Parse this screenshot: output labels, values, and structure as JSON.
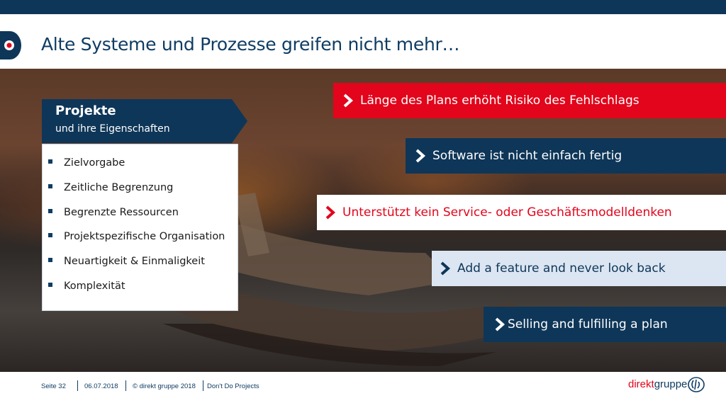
{
  "header": {
    "title": "Alte Systeme und Prozesse greifen nicht mehr…"
  },
  "projects": {
    "title": "Projekte",
    "subtitle": "und ihre Eigenschaften",
    "items": [
      "Zielvorgabe",
      "Zeitliche Begrenzung",
      "Begrenzte Ressourcen",
      "Projektspezifische Organisation",
      "Neuartigkeit & Einmaligkeit",
      "Komplexität"
    ]
  },
  "callouts": [
    {
      "text": "Länge des Plans erhöht Risiko des Fehlschlags",
      "bg": "#e2051b",
      "fg": "#ffffff"
    },
    {
      "text": "Software ist nicht einfach fertig",
      "bg": "#0e3658",
      "fg": "#ffffff"
    },
    {
      "text": "Unterstützt kein Service- oder Geschäftsmodelldenken",
      "bg": "#ffffff",
      "fg": "#e2051b"
    },
    {
      "text": "Add a feature and never look back",
      "bg": "#dce6f2",
      "fg": "#0e3658"
    },
    {
      "text": "Selling and fulfilling a plan",
      "bg": "#0e3658",
      "fg": "#ffffff"
    }
  ],
  "footer": {
    "page": "Seite  32",
    "date": "06.07.2018",
    "copyright": "© direkt gruppe 2018",
    "topic": "Don't Do Projects",
    "brand_a": "direkt",
    "brand_b": "gruppe"
  },
  "colors": {
    "navy": "#0e3658",
    "red": "#e2051b",
    "light_blue": "#dce6f2"
  }
}
